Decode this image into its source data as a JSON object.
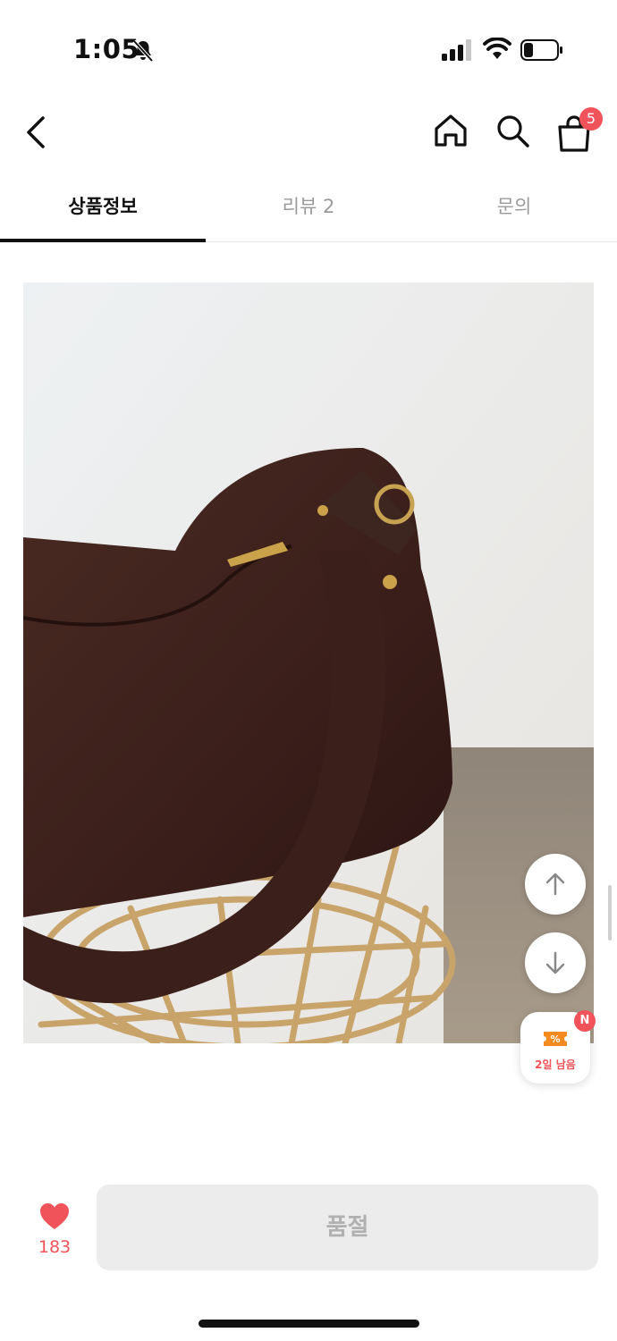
{
  "status_bar": {
    "time": "1:05",
    "icons": [
      "bell-slash-icon",
      "signal-icon",
      "wifi-icon",
      "battery-icon"
    ]
  },
  "header": {
    "icons": [
      "back-icon",
      "home-icon",
      "search-icon",
      "cart-icon"
    ],
    "cart_count": "5"
  },
  "tabs": [
    {
      "label": "상품정보",
      "active": true
    },
    {
      "label": "리뷰 2",
      "active": false
    },
    {
      "label": "문의",
      "active": false
    }
  ],
  "product_image": {
    "subject": "brown suede shoulder bag on wicker stool"
  },
  "floating": {
    "scroll_up_icon": "arrow-up-icon",
    "scroll_down_icon": "arrow-down-icon",
    "coupon_label": "2일 남음",
    "coupon_badge": "N"
  },
  "bottom_bar": {
    "like_count": "183",
    "soldout_label": "품절"
  },
  "colors": {
    "accent": "#f0535a",
    "coupon_orange": "#f58a1f",
    "disabled_bg": "#ececec",
    "disabled_text": "#b0b0b0"
  }
}
